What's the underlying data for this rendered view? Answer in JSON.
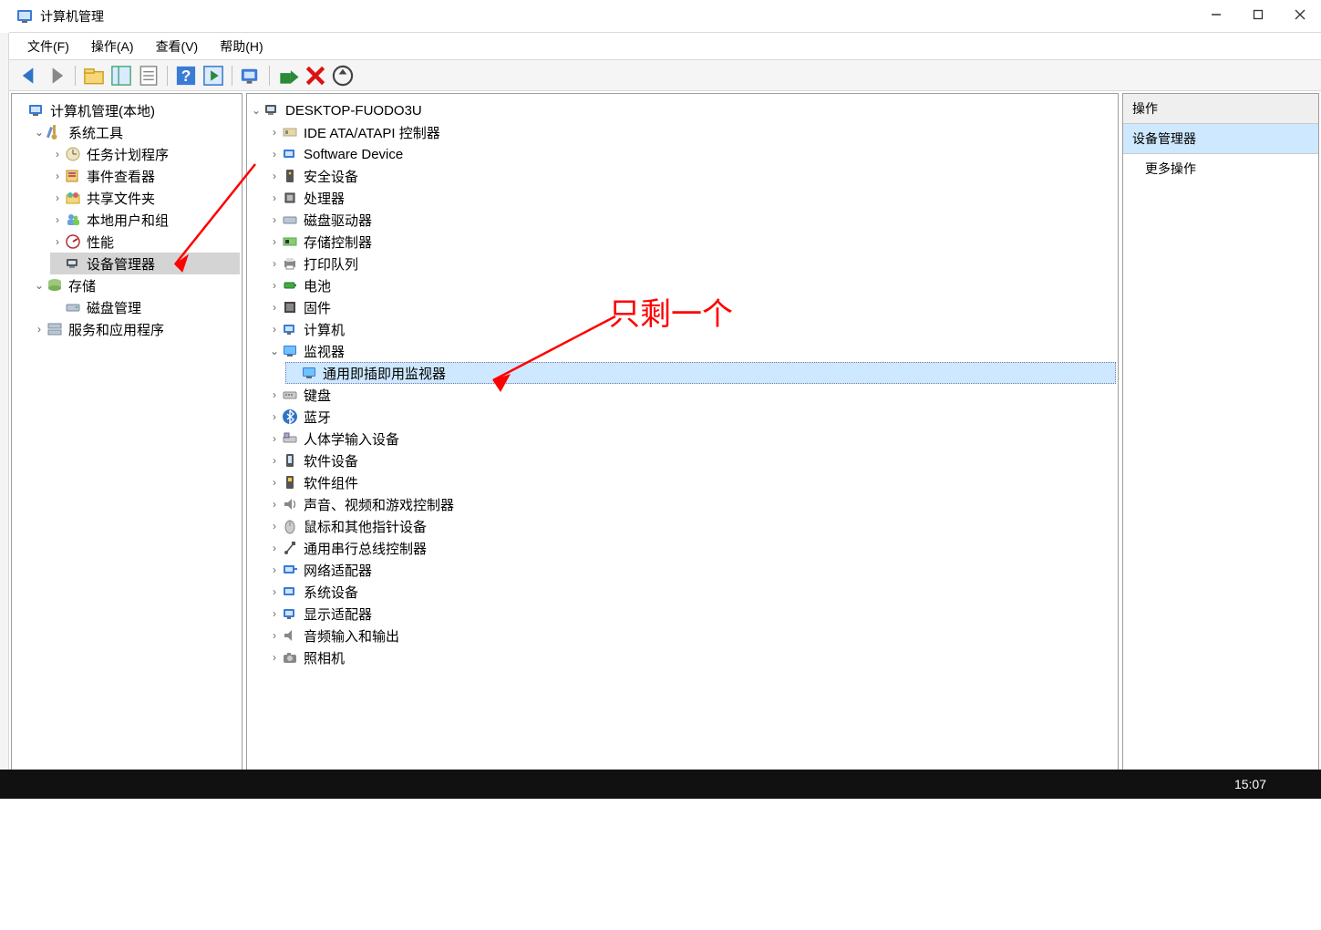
{
  "window": {
    "title": "计算机管理"
  },
  "menu": {
    "file": "文件(F)",
    "action": "操作(A)",
    "view": "查看(V)",
    "help": "帮助(H)"
  },
  "left_tree": {
    "root": "计算机管理(本地)",
    "system_tools": "系统工具",
    "task_scheduler": "任务计划程序",
    "event_viewer": "事件查看器",
    "shared_folders": "共享文件夹",
    "local_users": "本地用户和组",
    "performance": "性能",
    "device_manager": "设备管理器",
    "storage": "存储",
    "disk_mgmt": "磁盘管理",
    "services_apps": "服务和应用程序"
  },
  "devices": {
    "root": "DESKTOP-FUODO3U",
    "ide": "IDE ATA/ATAPI 控制器",
    "software_device": "Software Device",
    "security_dev": "安全设备",
    "cpu": "处理器",
    "disk_drive": "磁盘驱动器",
    "storage_ctrl": "存储控制器",
    "print_queue": "打印队列",
    "battery": "电池",
    "firmware": "固件",
    "computer": "计算机",
    "monitor": "监视器",
    "pnp_monitor": "通用即插即用监视器",
    "keyboard": "键盘",
    "bluetooth": "蓝牙",
    "hid": "人体学输入设备",
    "soft_dev": "软件设备",
    "soft_comp": "软件组件",
    "sound": "声音、视频和游戏控制器",
    "mouse": "鼠标和其他指针设备",
    "usb": "通用串行总线控制器",
    "network": "网络适配器",
    "sys_dev": "系统设备",
    "display": "显示适配器",
    "audio_io": "音频输入和输出",
    "camera": "照相机"
  },
  "right": {
    "header": "操作",
    "title": "设备管理器",
    "more": "更多操作"
  },
  "annotation": {
    "text": "只剩一个"
  },
  "taskbar": {
    "time": "15:07"
  }
}
